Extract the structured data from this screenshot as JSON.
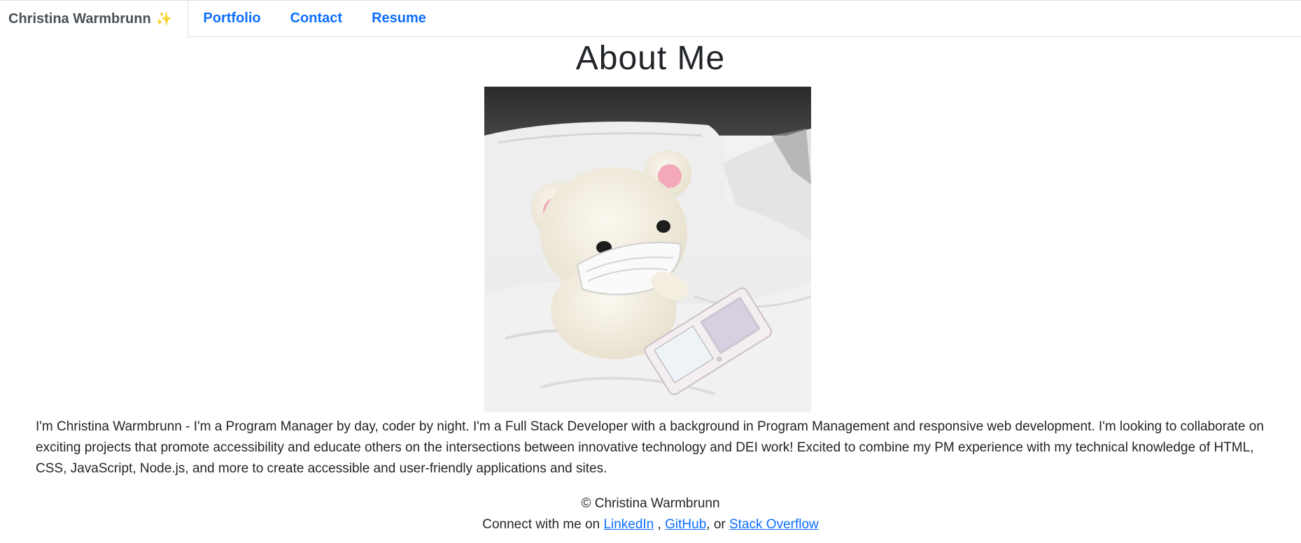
{
  "nav": {
    "brand": "Christina Warmbrunn",
    "brand_icon": "sparkles-icon",
    "brand_icon_glyph": "✨",
    "links": [
      "Portfolio",
      "Contact",
      "Resume"
    ]
  },
  "main": {
    "title": "About Me",
    "photo_description_icon": "teddy-bear-photo",
    "bio": "I'm Christina Warmbrunn - I'm a Program Manager by day, coder by night. I'm a Full Stack Developer with a background in Program Management and responsive web development. I'm looking to collaborate on exciting projects that promote accessibility and educate others on the intersections between innovative technology and DEI work! Excited to combine my PM experience with my technical knowledge of HTML, CSS, JavaScript, Node.js, and more to create accessible and user-friendly applications and sites."
  },
  "footer": {
    "copyright": "© Christina Warmbrunn",
    "connect_prefix": "Connect with me on ",
    "linkedin": "LinkedIn",
    "sep1": " , ",
    "github": "GitHub",
    "sep2": ", or ",
    "stackoverflow": "Stack Overflow"
  },
  "colors": {
    "link": "#0d6efd",
    "brand_text": "#495057",
    "body_text": "#212529",
    "border": "#dee2e6"
  }
}
